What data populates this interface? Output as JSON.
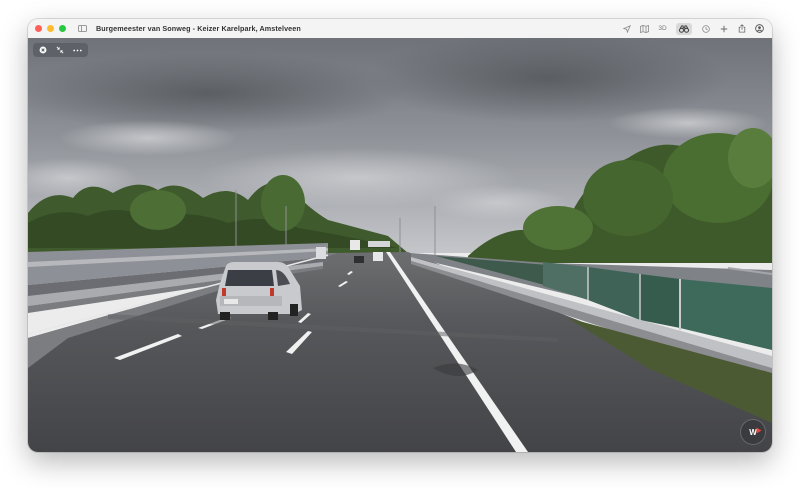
{
  "window": {
    "title": "Burgemeester van Sonweg - Keizer Karelpark, Amstelveen",
    "traffic_lights": {
      "close": "#ff5f57",
      "minimize": "#febc2e",
      "zoom": "#28c840"
    }
  },
  "toolbar": {
    "items": [
      {
        "icon": "location-arrow-icon"
      },
      {
        "icon": "map-icon"
      },
      {
        "icon": "3d-label",
        "label": "3D"
      },
      {
        "icon": "binoculars-icon",
        "active": true
      },
      {
        "icon": "clock-icon"
      },
      {
        "icon": "plus-icon"
      },
      {
        "icon": "share-icon"
      },
      {
        "icon": "account-icon"
      }
    ]
  },
  "lookaround": {
    "controls": [
      {
        "icon": "close-icon"
      },
      {
        "icon": "collapse-icon"
      },
      {
        "icon": "more-icon"
      }
    ],
    "compass": {
      "heading": "W"
    }
  },
  "colors": {
    "accent": "#e4473b",
    "road": "#4b4c4f",
    "sky": "#9b9ea4"
  }
}
